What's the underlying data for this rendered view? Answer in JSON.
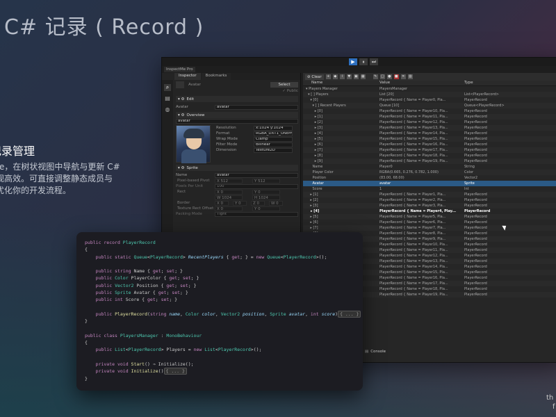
{
  "page": {
    "title": "C# 记录 ( Record )",
    "side_heading": "记录管理",
    "side_lines": [
      "ectMe，在树状视图中导航与更新 C#",
      "得直观高效。可直接调整静态成员与",
      "从而优化你的开发流程。"
    ],
    "corner_text": "th",
    "corner_text2": "f"
  },
  "window": {
    "app_title": "InspectMe Pro",
    "play_buttons": [
      "▶",
      "⏸",
      "⏭"
    ]
  },
  "inspector": {
    "tabs": [
      "Inspector",
      "Bookmarks"
    ],
    "side_icons": [
      "zoom-icon",
      "trash-icon",
      "globe-icon"
    ],
    "object_name": "Avatar",
    "select_label": "Select",
    "public_label": "✓ Public",
    "edit_label": "Edit",
    "avatar_label": "Avatar",
    "avatar_value": "avatar",
    "overview_label": "Overview",
    "overview_name": "avatar",
    "overview_rows": [
      {
        "k": "Resolution",
        "v": "x:1024 y:1024"
      },
      {
        "k": "Format",
        "v": "RGBA_DXT1_UNorm"
      },
      {
        "k": "Wrap Mode",
        "v": "Clamp"
      },
      {
        "k": "Filter Mode",
        "v": "Bilinear"
      },
      {
        "k": "Dimension",
        "v": "Texture2D"
      }
    ],
    "sprite_label": "Sprite",
    "sprite_rows": {
      "name_label": "Name",
      "name_value": "avatar",
      "pivot_label": "Pixel-based Pivot",
      "pivot_x": "X 512",
      "pivot_y": "Y 512",
      "ppu_label": "Pixels Per Unit",
      "ppu_value": "100",
      "rect_label": "Rect",
      "rect_x": "X 0",
      "rect_y": "Y 0",
      "rect_w": "W 1024",
      "rect_h": "H 1024",
      "border_label": "Border",
      "border_x": "X 0",
      "border_y": "Y 0",
      "border_z": "Z 0",
      "border_w": "W 0",
      "tro_label": "Texture Rect Offset",
      "tro_x": "X 0",
      "tro_y": "Y 0",
      "packing_label": "Packing Mode",
      "packing_value": "Tight"
    }
  },
  "tree": {
    "toolbar_clear": "Clear",
    "columns": [
      "Name",
      "Value",
      "Type"
    ],
    "rows": [
      {
        "name": "▾ Players Manager",
        "value": "PlayersManager",
        "type": ""
      },
      {
        "name": "  ▾ [ ] Players",
        "value": "List [20]",
        "type": "List<PlayerRecord>"
      },
      {
        "name": "    ▾ [0]",
        "value": "PlayerRecord { Name = Player0, Pla...",
        "type": "PlayerRecord"
      },
      {
        "name": "      ▾ [ ] Recent Players",
        "value": "Queue [10]",
        "type": "Queue<PlayerRecord>"
      },
      {
        "name": "        ▸ [0]",
        "value": "PlayerRecord { Name = Player10, Pla...",
        "type": "PlayerRecord"
      },
      {
        "name": "        ▸ [1]",
        "value": "PlayerRecord { Name = Player11, Pla...",
        "type": "PlayerRecord"
      },
      {
        "name": "        ▸ [2]",
        "value": "PlayerRecord { Name = Player12, Pla...",
        "type": "PlayerRecord"
      },
      {
        "name": "        ▸ [3]",
        "value": "PlayerRecord { Name = Player13, Pla...",
        "type": "PlayerRecord"
      },
      {
        "name": "        ▸ [4]",
        "value": "PlayerRecord { Name = Player14, Pla...",
        "type": "PlayerRecord"
      },
      {
        "name": "        ▸ [5]",
        "value": "PlayerRecord { Name = Player15, Pla...",
        "type": "PlayerRecord"
      },
      {
        "name": "        ▸ [6]",
        "value": "PlayerRecord { Name = Player16, Pla...",
        "type": "PlayerRecord"
      },
      {
        "name": "        ▸ [7]",
        "value": "PlayerRecord { Name = Player17, Pla...",
        "type": "PlayerRecord"
      },
      {
        "name": "        ▸ [8]",
        "value": "PlayerRecord { Name = Player18, Pla...",
        "type": "PlayerRecord"
      },
      {
        "name": "        ▸ [9]",
        "value": "PlayerRecord { Name = Player19, Pla...",
        "type": "PlayerRecord"
      },
      {
        "name": "      Name",
        "value": "Player0",
        "type": "String"
      },
      {
        "name": "      Player Color",
        "value": "RGBA(0.665, 0.276, 0.782, 1.000)",
        "type": "Color"
      },
      {
        "name": "      Position",
        "value": "(83.00, 68.00)",
        "type": "Vector2"
      },
      {
        "name": "      Avatar",
        "value": "avatar",
        "type": "Sprite",
        "sel": true
      },
      {
        "name": "      Score",
        "value": "1",
        "type": "Int"
      },
      {
        "name": "    ▸ [1]",
        "value": "PlayerRecord { Name = Player1, Pla...",
        "type": "PlayerRecord"
      },
      {
        "name": "    ▸ [2]",
        "value": "PlayerRecord { Name = Player2, Pla...",
        "type": "PlayerRecord"
      },
      {
        "name": "    ▸ [3]",
        "value": "PlayerRecord { Name = Player3, Pla...",
        "type": "PlayerRecord"
      },
      {
        "name": "    ▸ [4]",
        "value": "PlayerRecord { Name = Player4, Play...",
        "type": "PlayerRecord",
        "bold": true
      },
      {
        "name": "    ▸ [5]",
        "value": "PlayerRecord { Name = Player5, Pla...",
        "type": "PlayerRecord"
      },
      {
        "name": "    ▸ [6]",
        "value": "PlayerRecord { Name = Player6, Pla...",
        "type": "PlayerRecord"
      },
      {
        "name": "    ▸ [7]",
        "value": "PlayerRecord { Name = Player7, Pla...",
        "type": "PlayerRecord"
      },
      {
        "name": "    ▸ [8]",
        "value": "PlayerRecord { Name = Player8, Pla...",
        "type": "PlayerRecord"
      },
      {
        "name": "    ▸ [9]",
        "value": "PlayerRecord { Name = Player9, Pla...",
        "type": "PlayerRecord"
      },
      {
        "name": "    ▸ [10]",
        "value": "PlayerRecord { Name = Player10, Pla...",
        "type": "PlayerRecord"
      },
      {
        "name": "    ▸ [11]",
        "value": "PlayerRecord { Name = Player11, Pla...",
        "type": "PlayerRecord"
      },
      {
        "name": "    ▸ [12]",
        "value": "PlayerRecord { Name = Player12, Pla...",
        "type": "PlayerRecord"
      },
      {
        "name": "    ▸ [13]",
        "value": "PlayerRecord { Name = Player13, Pla...",
        "type": "PlayerRecord"
      },
      {
        "name": "    ▸ [14]",
        "value": "PlayerRecord { Name = Player14, Pla...",
        "type": "PlayerRecord"
      },
      {
        "name": "    ▸ [15]",
        "value": "PlayerRecord { Name = Player15, Pla...",
        "type": "PlayerRecord"
      },
      {
        "name": "    ▸ [16]",
        "value": "PlayerRecord { Name = Player16, Pla...",
        "type": "PlayerRecord"
      },
      {
        "name": "    ▸ [17]",
        "value": "PlayerRecord { Name = Player17, Pla...",
        "type": "PlayerRecord"
      },
      {
        "name": "    ▸ [18]",
        "value": "PlayerRecord { Name = Player18, Pla...",
        "type": "PlayerRecord"
      },
      {
        "name": "    ▸ [19]",
        "value": "PlayerRecord { Name = Player19, Pla...",
        "type": "PlayerRecord"
      }
    ],
    "console_label": "Console"
  },
  "code": {
    "lines": [
      [
        [
          "kw",
          "public record "
        ],
        [
          "ty",
          "PlayerRecord"
        ]
      ],
      [
        [
          "",
          "{"
        ]
      ],
      [
        [
          "",
          "    "
        ],
        [
          "kw",
          "public static "
        ],
        [
          "ty",
          "Queue"
        ],
        [
          "",
          "<"
        ],
        [
          "ty",
          "PlayerRecord"
        ],
        [
          "",
          "> "
        ],
        [
          "it",
          "RecentPlayers"
        ],
        [
          "",
          " { "
        ],
        [
          "kw",
          "get"
        ],
        [
          "",
          "; } = "
        ],
        [
          "kw",
          "new "
        ],
        [
          "ty",
          "Queue"
        ],
        [
          "",
          "<"
        ],
        [
          "ty",
          "PlayerRecord"
        ],
        [
          "",
          ">();"
        ]
      ],
      [
        [
          "",
          ""
        ]
      ],
      [
        [
          "",
          "    "
        ],
        [
          "kw",
          "public string "
        ],
        [
          "",
          "Name { "
        ],
        [
          "kw",
          "get"
        ],
        [
          "",
          "; "
        ],
        [
          "kw",
          "set"
        ],
        [
          "",
          "; }"
        ]
      ],
      [
        [
          "",
          "    "
        ],
        [
          "kw",
          "public "
        ],
        [
          "ty",
          "Color "
        ],
        [
          "",
          "PlayerColor { "
        ],
        [
          "kw",
          "get"
        ],
        [
          "",
          "; "
        ],
        [
          "kw",
          "set"
        ],
        [
          "",
          "; }"
        ]
      ],
      [
        [
          "",
          "    "
        ],
        [
          "kw",
          "public "
        ],
        [
          "ty",
          "Vector2 "
        ],
        [
          "",
          "Position { "
        ],
        [
          "kw",
          "get"
        ],
        [
          "",
          "; "
        ],
        [
          "kw",
          "set"
        ],
        [
          "",
          "; }"
        ]
      ],
      [
        [
          "",
          "    "
        ],
        [
          "kw",
          "public "
        ],
        [
          "ty",
          "Sprite "
        ],
        [
          "",
          "Avatar { "
        ],
        [
          "kw",
          "get"
        ],
        [
          "",
          "; "
        ],
        [
          "kw",
          "set"
        ],
        [
          "",
          "; }"
        ]
      ],
      [
        [
          "",
          "    "
        ],
        [
          "kw",
          "public int "
        ],
        [
          "",
          "Score { "
        ],
        [
          "kw",
          "get"
        ],
        [
          "",
          "; "
        ],
        [
          "kw",
          "set"
        ],
        [
          "",
          "; }"
        ]
      ],
      [
        [
          "",
          ""
        ]
      ],
      [
        [
          "",
          "    "
        ],
        [
          "kw",
          "public "
        ],
        [
          "fn",
          "PlayerRecord"
        ],
        [
          "",
          "("
        ],
        [
          "kw",
          "string "
        ],
        [
          "it",
          "name"
        ],
        [
          ", "
        ],
        [
          "ty",
          "Color "
        ],
        [
          "it",
          "color"
        ],
        [
          ", "
        ],
        [
          "ty",
          "Vector2 "
        ],
        [
          "it",
          "position"
        ],
        [
          ", "
        ],
        [
          "ty",
          "Sprite "
        ],
        [
          "it",
          "avatar"
        ],
        [
          ", "
        ],
        [
          "kw",
          "int "
        ],
        [
          "it",
          "score"
        ],
        [
          ")"
        ],
        [
          "fold",
          "{ ... }"
        ]
      ],
      [
        [
          "",
          "}"
        ]
      ],
      [
        [
          "",
          ""
        ]
      ],
      [
        [
          "kw",
          "public class "
        ],
        [
          "ty",
          "PlayersManager"
        ],
        [
          "",
          " : "
        ],
        [
          "ty",
          "MonoBehaviour"
        ]
      ],
      [
        [
          "",
          "{"
        ]
      ],
      [
        [
          "",
          "    "
        ],
        [
          "kw",
          "public "
        ],
        [
          "ty",
          "List"
        ],
        [
          "",
          "<"
        ],
        [
          "ty",
          "PlayerRecord"
        ],
        [
          "",
          "> Players = "
        ],
        [
          "kw",
          "new "
        ],
        [
          "ty",
          "List"
        ],
        [
          "",
          "<"
        ],
        [
          "ty",
          "PlayerRecord"
        ],
        [
          "",
          ">();"
        ]
      ],
      [
        [
          "",
          ""
        ]
      ],
      [
        [
          "",
          "    "
        ],
        [
          "kw",
          "private void "
        ],
        [
          "fn",
          "Start"
        ],
        [
          "",
          "() ⇒ Initialize();"
        ]
      ],
      [
        [
          "",
          "    "
        ],
        [
          "kw",
          "private void "
        ],
        [
          "fn",
          "Initialize"
        ],
        [
          "",
          "()"
        ],
        [
          "fold",
          "{ ... }"
        ]
      ],
      [
        [
          "",
          "}"
        ]
      ]
    ]
  }
}
